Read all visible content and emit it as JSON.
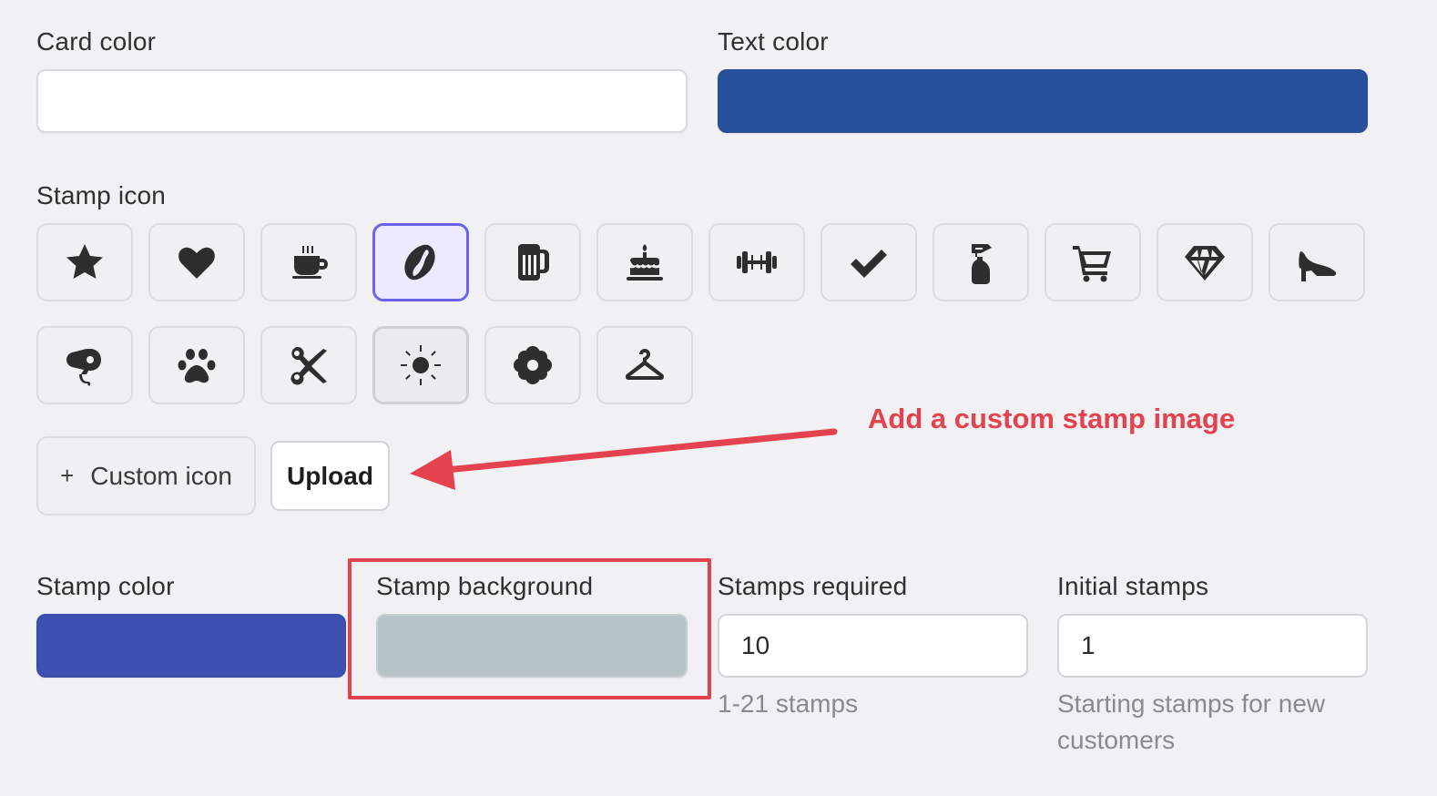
{
  "card_color": {
    "label": "Card color",
    "value": "#ffffff"
  },
  "text_color": {
    "label": "Text color",
    "value": "#27519c"
  },
  "stamp_icon": {
    "label": "Stamp icon",
    "icons": [
      "star-icon",
      "heart-icon",
      "coffee-cup-icon",
      "coffee-bean-icon",
      "beer-mug-icon",
      "cake-icon",
      "dumbbell-icon",
      "checkmark-icon",
      "spray-bottle-icon",
      "shopping-cart-icon",
      "diamond-icon",
      "high-heel-icon",
      "hair-dryer-icon",
      "paw-icon",
      "scissors-icon",
      "sun-icon",
      "flower-icon",
      "hanger-icon"
    ],
    "selected": "coffee-bean-icon",
    "hovered": "sun-icon"
  },
  "custom_icon": {
    "plus": "+",
    "label": "Custom icon",
    "upload_label": "Upload"
  },
  "annotation": {
    "text": "Add a custom stamp image",
    "color": "#e4424f"
  },
  "stamp_color": {
    "label": "Stamp color",
    "value": "#3c51b1"
  },
  "stamp_background": {
    "label": "Stamp background",
    "value": "#b6c4c8"
  },
  "stamps_required": {
    "label": "Stamps required",
    "value": "10",
    "helper": "1-21 stamps"
  },
  "initial_stamps": {
    "label": "Initial stamps",
    "value": "1",
    "helper_line1": "Starting stamps for new",
    "helper_line2": "customers"
  }
}
